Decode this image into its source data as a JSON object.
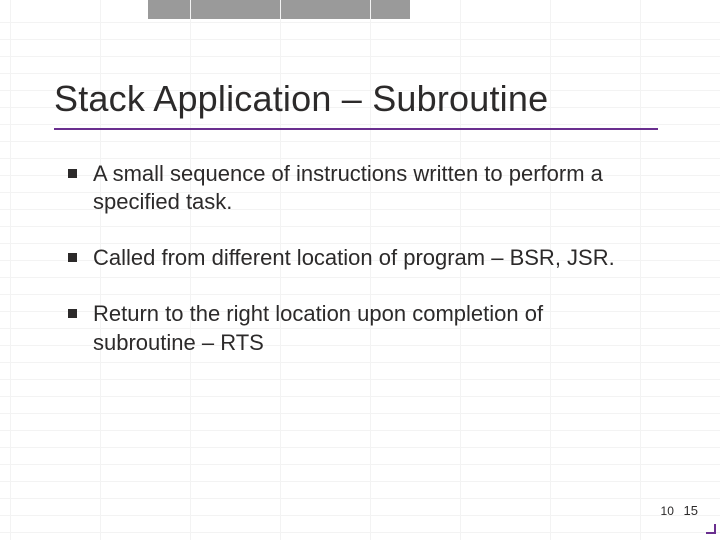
{
  "title": "Stack Application – Subroutine",
  "bullets": [
    "A small sequence of instructions written to perform a specified task.",
    "Called from different location of program – BSR, JSR.",
    "Return to the right location upon completion of subroutine – RTS"
  ],
  "page": {
    "inner": "10",
    "outer": "15"
  },
  "accent_color": "#6a2f8f"
}
